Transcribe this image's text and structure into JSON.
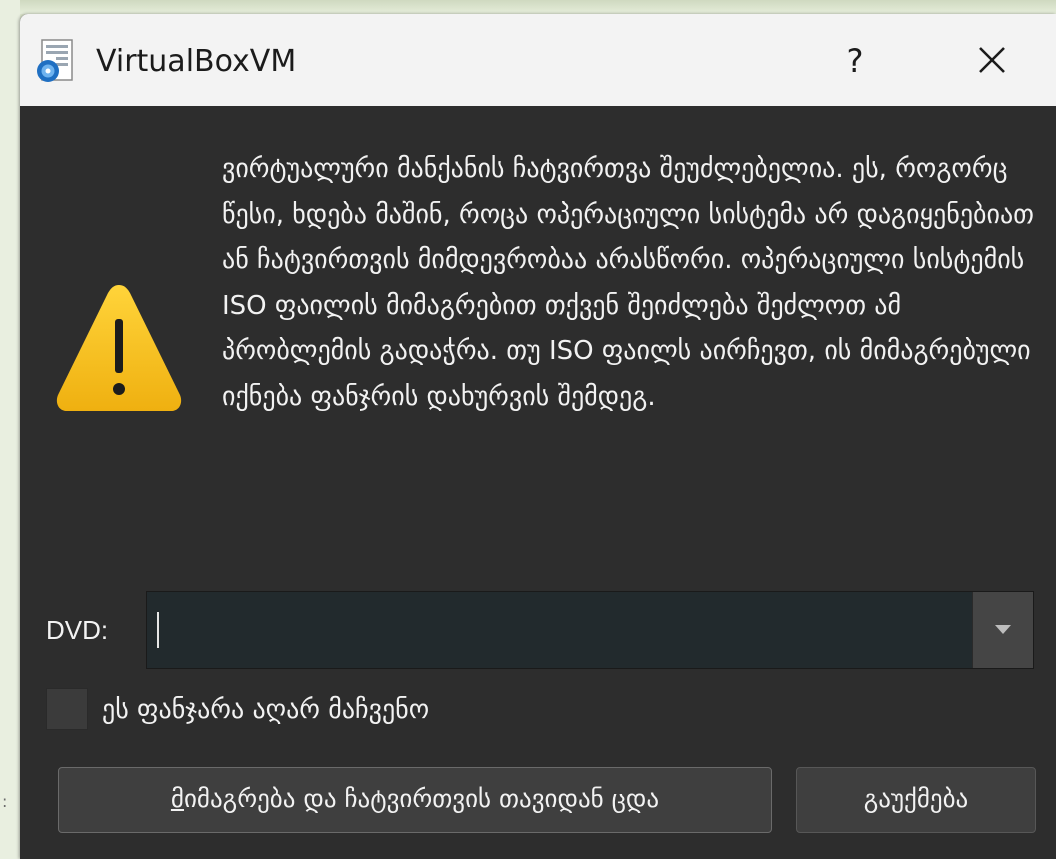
{
  "window": {
    "title": "VirtualBoxVM",
    "help_label": "?",
    "close_icon": "close-icon",
    "app_icon": "virtualbox-vm-icon"
  },
  "message": {
    "icon": "warning-icon",
    "text": "ვირტუალური მანქანის ჩატვირთვა შეუძლებელია. ეს, როგორც წესი, ხდება მაშინ, როცა ოპერაციული სისტემა არ დაგიყენებიათ ან ჩატვირთვის მიმდევრობაა არასწორი. ოპერაციული სისტემის ISO ფაილის მიმაგრებით თქვენ შეიძლება შეძლოთ ამ პრობლემის გადაჭრა. თუ ISO ფაილს აირჩევთ, ის მიმაგრებული იქნება ფანჯრის დახურვის შემდეგ."
  },
  "dvd": {
    "label": "DVD:",
    "value": "",
    "dropdown_icon": "chevron-down-icon"
  },
  "dont_show": {
    "checked": false,
    "label": "ეს ფანჯარა აღარ მაჩვენო"
  },
  "buttons": {
    "mount_mnemonic": "მ",
    "mount_rest": "იმაგრება და ჩატვირთვის თავიდან ცდა",
    "cancel": "გაუქმება"
  },
  "colors": {
    "dialog_bg": "#2d2d2d",
    "titlebar_bg": "#f3f3f3",
    "warning_yellow": "#f5c21b"
  }
}
